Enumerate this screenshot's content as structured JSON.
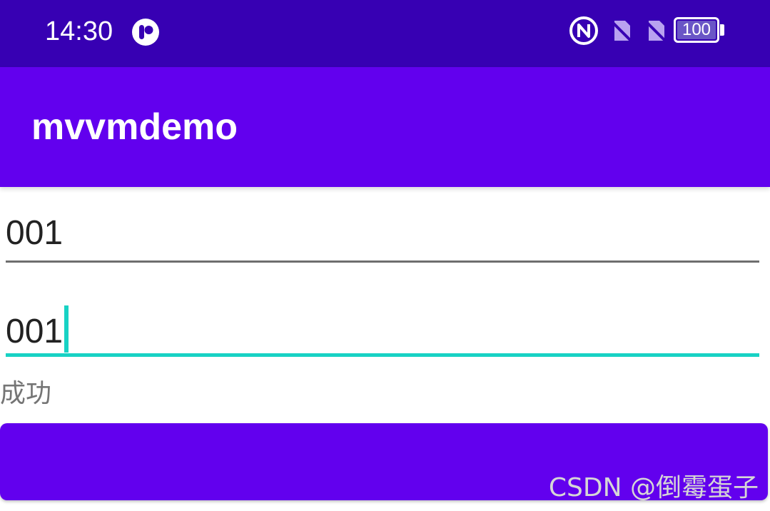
{
  "status_bar": {
    "time": "14:30",
    "battery_level": "100",
    "icons": [
      "app-r-icon",
      "nfc-icon",
      "no-sim-icon",
      "no-sim-icon",
      "battery-icon"
    ],
    "background": "#3700b3"
  },
  "app_bar": {
    "title": "mvvmdemo",
    "background": "#6200ee"
  },
  "form": {
    "field_1_value": "001",
    "field_2_value": "001",
    "status_text": "成功",
    "focus_color": "#18d2c4"
  },
  "button": {
    "label": "",
    "background": "#6200ee"
  },
  "watermark": "CSDN @倒霉蛋子"
}
